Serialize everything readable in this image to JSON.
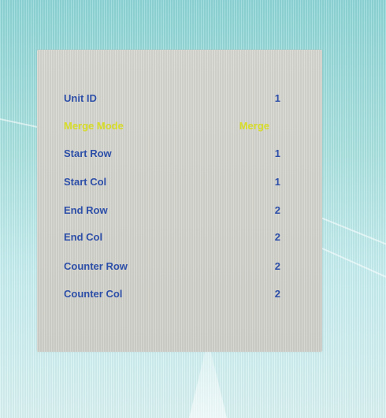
{
  "menu": {
    "items": [
      {
        "label": "Unit ID",
        "value": "1",
        "selected": false
      },
      {
        "label": "Merge Mode",
        "value": "Merge",
        "selected": true
      },
      {
        "label": "Start Row",
        "value": "1",
        "selected": false
      },
      {
        "label": "Start Col",
        "value": "1",
        "selected": false
      },
      {
        "label": "End Row",
        "value": "2",
        "selected": false
      },
      {
        "label": "End Col",
        "value": "2",
        "selected": false
      },
      {
        "label": "Counter Row",
        "value": "2",
        "selected": false
      },
      {
        "label": "Counter Col",
        "value": "2",
        "selected": false
      }
    ]
  },
  "controls": {
    "buttons": [
      {
        "icon": "enter-icon"
      },
      {
        "icon": "exit-icon"
      },
      {
        "icon": "chevron-left-icon"
      },
      {
        "icon": "chevron-right-icon"
      }
    ]
  },
  "colors": {
    "menu_text": "#2d4fa8",
    "selected_text": "#d9df2b",
    "panel_bg": "#d4d4ce",
    "background": "#a9e2e0"
  }
}
